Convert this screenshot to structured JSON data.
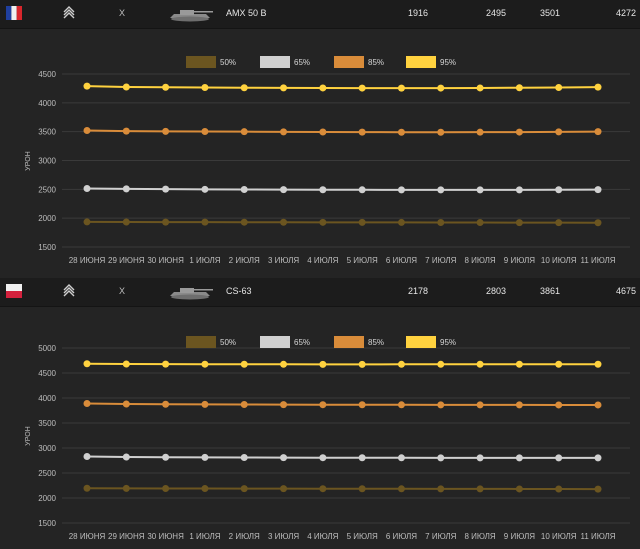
{
  "colors": {
    "p50": "#6b5520",
    "p65": "#d0d0d0",
    "p85": "#d98c3a",
    "p95": "#ffd23f",
    "grid": "#3a3a3a",
    "bg": "#242424"
  },
  "panels": [
    {
      "flag": "france-flag-icon",
      "tier_icon": "tier-chevrons-icon",
      "level": "X",
      "tank_icon": "tank-icon",
      "tank_name": "AMX 50 B",
      "values": [
        "1916",
        "2495",
        "3501",
        "4272"
      ]
    },
    {
      "flag": "poland-flag-icon",
      "tier_icon": "tier-chevrons-icon",
      "level": "X",
      "tank_icon": "tank-icon",
      "tank_name": "CS-63",
      "values": [
        "2178",
        "2803",
        "3861",
        "4675"
      ]
    }
  ],
  "chart_data": [
    {
      "type": "line",
      "ylabel": "УРОН",
      "ylim": [
        1500,
        4500
      ],
      "yticks": [
        1500,
        2000,
        2500,
        3000,
        3500,
        4000,
        4500
      ],
      "grid": true,
      "legend_position": "top-center",
      "categories": [
        "28 июня",
        "29 июня",
        "30 июня",
        "1 июля",
        "2 июля",
        "3 июля",
        "4 июля",
        "5 июля",
        "6 июля",
        "7 июля",
        "8 июля",
        "9 июля",
        "10 июля",
        "11 июля"
      ],
      "series": [
        {
          "name": "50%",
          "values": [
            1935,
            1933,
            1932,
            1931,
            1930,
            1929,
            1928,
            1927,
            1926,
            1925,
            1924,
            1923,
            1922,
            1920
          ]
        },
        {
          "name": "65%",
          "values": [
            2515,
            2508,
            2503,
            2500,
            2497,
            2495,
            2493,
            2492,
            2491,
            2490,
            2490,
            2491,
            2493,
            2495
          ]
        },
        {
          "name": "85%",
          "values": [
            3520,
            3510,
            3505,
            3503,
            3500,
            3497,
            3494,
            3492,
            3490,
            3490,
            3491,
            3493,
            3496,
            3501
          ]
        },
        {
          "name": "95%",
          "values": [
            4290,
            4275,
            4270,
            4266,
            4262,
            4260,
            4258,
            4256,
            4255,
            4256,
            4258,
            4262,
            4266,
            4272
          ]
        }
      ]
    },
    {
      "type": "line",
      "ylabel": "УРОН",
      "ylim": [
        1500,
        5000
      ],
      "yticks": [
        1500,
        2000,
        2500,
        3000,
        3500,
        4000,
        4500,
        5000
      ],
      "grid": true,
      "legend_position": "top-center",
      "categories": [
        "28 июня",
        "29 июня",
        "30 июня",
        "1 июля",
        "2 июля",
        "3 июля",
        "4 июля",
        "5 июля",
        "6 июля",
        "7 июля",
        "8 июля",
        "9 июля",
        "10 июля",
        "11 июля"
      ],
      "series": [
        {
          "name": "50%",
          "values": [
            2195,
            2192,
            2190,
            2189,
            2188,
            2187,
            2186,
            2185,
            2184,
            2183,
            2182,
            2181,
            2180,
            2178
          ]
        },
        {
          "name": "65%",
          "values": [
            2830,
            2820,
            2815,
            2812,
            2810,
            2808,
            2806,
            2805,
            2804,
            2803,
            2802,
            2802,
            2803,
            2803
          ]
        },
        {
          "name": "85%",
          "values": [
            3890,
            3880,
            3875,
            3872,
            3870,
            3868,
            3866,
            3865,
            3864,
            3863,
            3862,
            3862,
            3861,
            3861
          ]
        },
        {
          "name": "95%",
          "values": [
            4685,
            4680,
            4678,
            4676,
            4675,
            4674,
            4673,
            4673,
            4674,
            4674,
            4675,
            4675,
            4675,
            4675
          ]
        }
      ]
    }
  ]
}
